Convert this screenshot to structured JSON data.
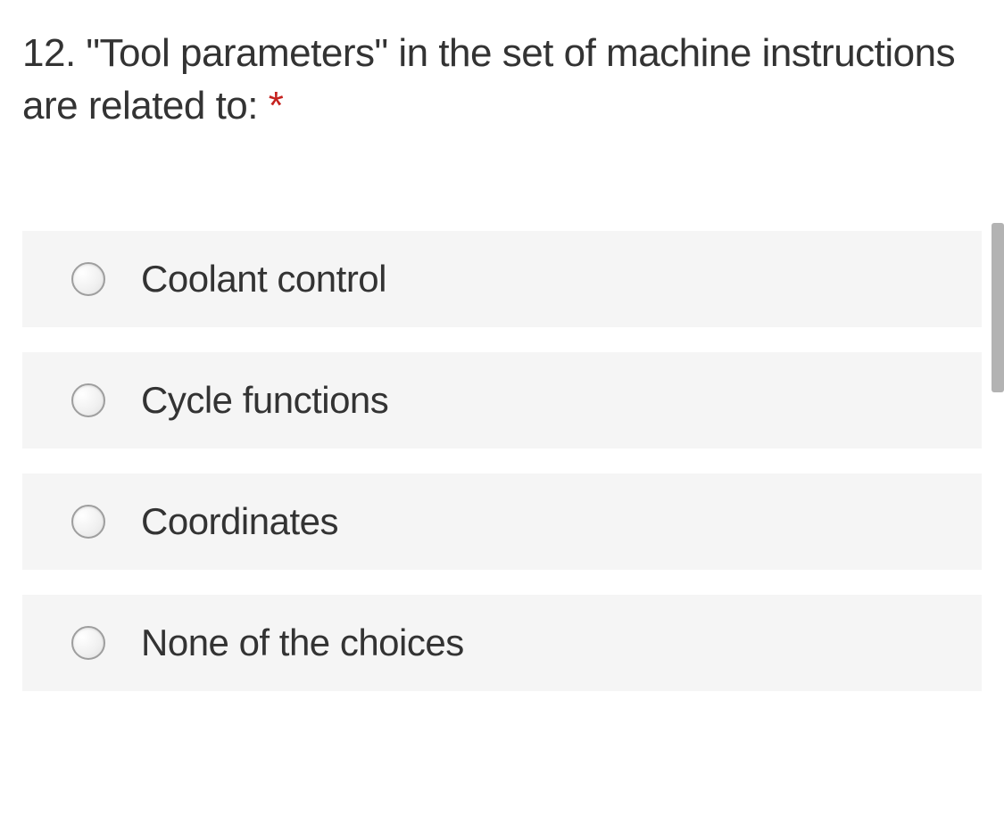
{
  "question": {
    "number": "12.",
    "text": "\"Tool parameters\" in the set of machine instructions are related to:",
    "required_marker": "*"
  },
  "options": [
    {
      "label": "Coolant control"
    },
    {
      "label": "Cycle functions"
    },
    {
      "label": "Coordinates"
    },
    {
      "label": "None of the choices"
    }
  ]
}
